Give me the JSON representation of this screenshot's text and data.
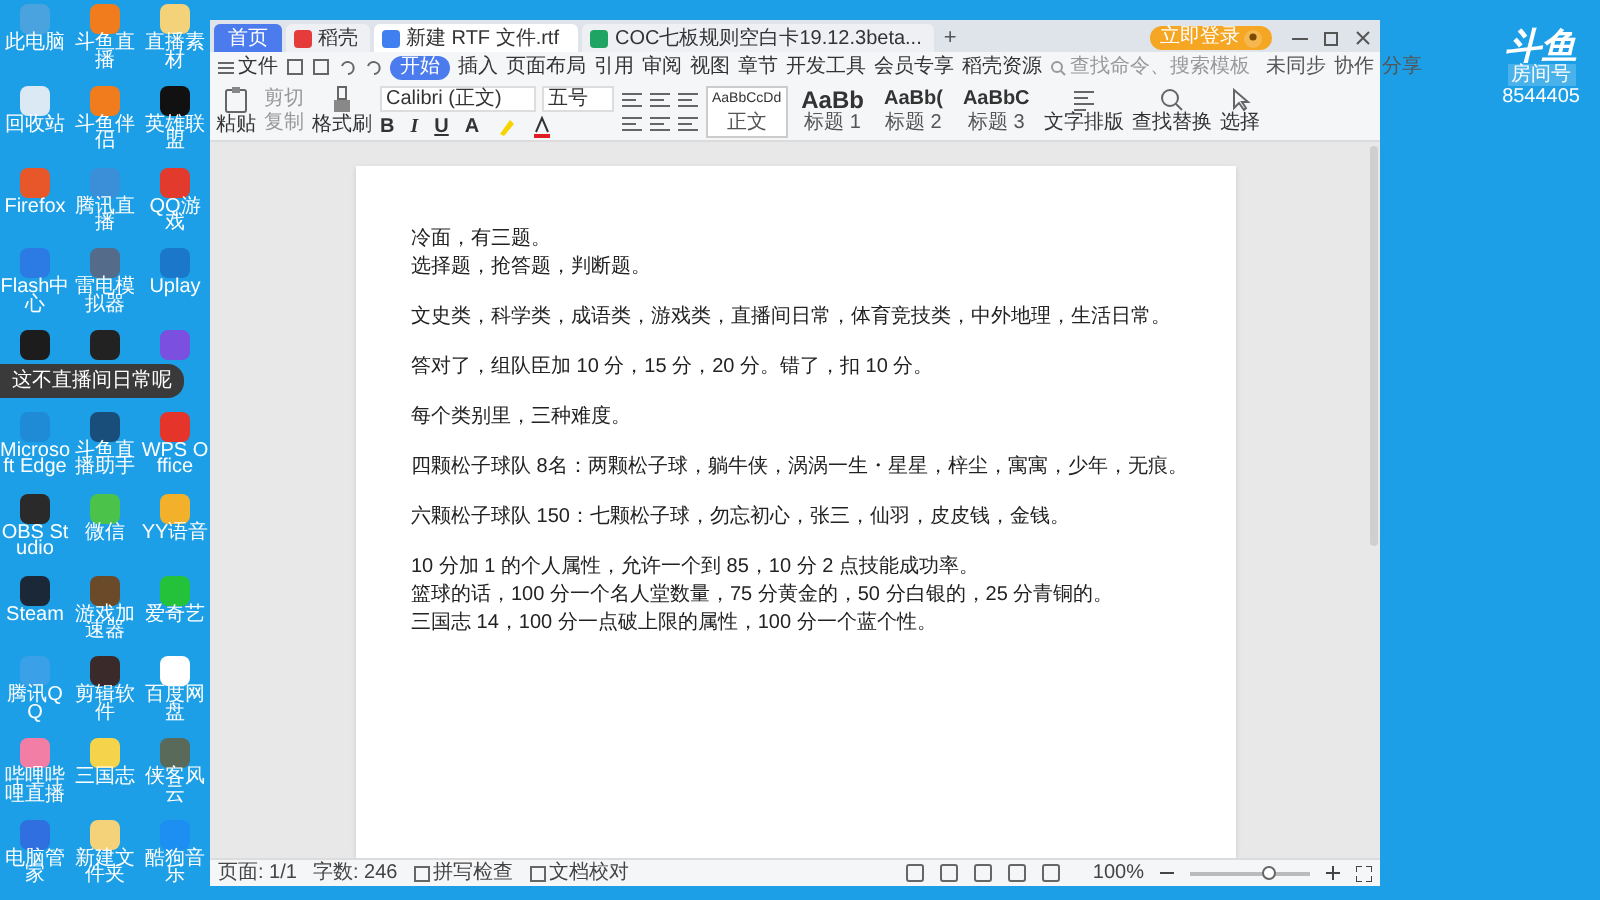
{
  "window": {
    "tabs": [
      {
        "label": "首页",
        "kind": "home",
        "selected": false
      },
      {
        "label": "稻壳",
        "kind": "docer",
        "selected": false
      },
      {
        "label": "新建 RTF 文件.rtf",
        "kind": "doc",
        "selected": true
      },
      {
        "label": "COC七板规则空白卡19.12.3beta...",
        "kind": "sheet",
        "selected": false
      }
    ],
    "new_tab": "+",
    "login": "立即登录"
  },
  "menu": {
    "file": "文件",
    "items": [
      {
        "label": "开始",
        "selected": true
      },
      {
        "label": "插入",
        "selected": false
      },
      {
        "label": "页面布局",
        "selected": false
      },
      {
        "label": "引用",
        "selected": false
      },
      {
        "label": "审阅",
        "selected": false
      },
      {
        "label": "视图",
        "selected": false
      },
      {
        "label": "章节",
        "selected": false
      },
      {
        "label": "开发工具",
        "selected": false
      },
      {
        "label": "会员专享",
        "selected": false
      },
      {
        "label": "稻壳资源",
        "selected": false
      }
    ],
    "search": {
      "placeholder": "查找命令、搜索模板"
    },
    "actions": [
      "未同步",
      "协作",
      "分享"
    ]
  },
  "ribbon": {
    "paste": "粘贴",
    "cut": "剪切",
    "copy": "复制",
    "format_painter": "格式刷",
    "font": "Calibri (正文)",
    "size": "五号",
    "format_buttons": [
      "B",
      "I",
      "U",
      "A"
    ],
    "styles": [
      {
        "preview": "AaBbCcDd",
        "label": "正文",
        "selected": true
      },
      {
        "preview": "AaBb",
        "label": "标题 1",
        "selected": false
      },
      {
        "preview": "AaBb(",
        "label": "标题 2",
        "selected": false
      },
      {
        "preview": "AaBbC",
        "label": "标题 3",
        "selected": false
      }
    ],
    "tools": [
      "文字排版",
      "查找替换",
      "选择"
    ]
  },
  "document": {
    "paragraphs": [
      [
        "冷面，有三题。",
        "选择题，抢答题，判断题。"
      ],
      [
        "文史类，科学类，成语类，游戏类，直播间日常，体育竞技类，中外地理，生活日常。"
      ],
      [
        "答对了，组队臣加 10 分，15 分，20 分。错了，扣 10 分。"
      ],
      [
        "每个类别里，三种难度。"
      ],
      [
        "四颗松子球队 8名：两颗松子球，躺牛侠，涡涡一生・星星，梓尘，寓寓，少年，无痕。"
      ],
      [
        "六颗松子球队 150：七颗松子球，勿忘初心，张三，仙羽，皮皮钱，金钱。"
      ],
      [
        "10 分加 1 的个人属性，允许一个到 85，10 分 2 点技能成功率。",
        "篮球的话，100 分一个名人堂数量，75 分黄金的，50 分白银的，25 分青铜的。",
        "三国志 14，100 分一点破上限的属性，100 分一个蓝个性。"
      ]
    ]
  },
  "status_bar": {
    "page": "页面: 1/1",
    "words": "字数: 246",
    "spell_check": "拼写检查",
    "proofread": "文档校对",
    "zoom": "100%",
    "zoom_slider": {
      "level": 0.65
    }
  },
  "desktop_icons": [
    {
      "label": "此电脑",
      "color": "#4aa3df"
    },
    {
      "label": "斗鱼直播",
      "color": "#f07c1e"
    },
    {
      "label": "直播素材",
      "color": "#f3d27a"
    },
    {
      "label": "回收站",
      "color": "#dbe9f5"
    },
    {
      "label": "斗鱼伴侣",
      "color": "#f07c1e"
    },
    {
      "label": "英雄联盟",
      "color": "#111111"
    },
    {
      "label": "Firefox",
      "color": "#e8572a"
    },
    {
      "label": "腾讯直播",
      "color": "#3a8fd8"
    },
    {
      "label": "QQ游戏",
      "color": "#e23b2e"
    },
    {
      "label": "Flash中心",
      "color": "#2c7be5"
    },
    {
      "label": "雷电模拟器",
      "color": "#556b8a"
    },
    {
      "label": "Uplay",
      "color": "#1b77c9"
    },
    {
      "color": "#1c1c1c"
    },
    {
      "color": "#222222"
    },
    {
      "color": "#7b4fe0"
    },
    {
      "label": "Microsoft Edge",
      "color": "#1f8bd6"
    },
    {
      "label": "斗鱼直播助手",
      "color": "#1a4e7a"
    },
    {
      "label": "WPS Office",
      "color": "#e5342a"
    },
    {
      "label": "OBS Studio",
      "color": "#2a2a2a"
    },
    {
      "label": "微信",
      "color": "#4bc34a"
    },
    {
      "label": "YY语音",
      "color": "#f2b02b"
    },
    {
      "label": "Steam",
      "color": "#1b2838"
    },
    {
      "label": "游戏加速器",
      "color": "#6b4a2a"
    },
    {
      "label": "爱奇艺",
      "color": "#24c13a"
    },
    {
      "label": "腾讯QQ",
      "color": "#3aa0e8"
    },
    {
      "label": "剪辑软件",
      "color": "#3a2a2a"
    },
    {
      "label": "百度网盘",
      "color": "#ffffff"
    },
    {
      "label": "哔哩哔哩直播",
      "color": "#f37ea5"
    },
    {
      "label": "三国志",
      "color": "#f5d34a"
    },
    {
      "label": "侠客风云",
      "color": "#5a6a5a"
    },
    {
      "label": "电脑管家",
      "color": "#2f6fe0"
    },
    {
      "label": "新建文件夹",
      "color": "#f3d27a"
    },
    {
      "label": "酷狗音乐",
      "color": "#1d8ff2"
    }
  ],
  "notification": "这不直播间日常呢",
  "stream_logo": {
    "brand": "斗鱼",
    "room_label": "房间号",
    "room": "8544405"
  }
}
